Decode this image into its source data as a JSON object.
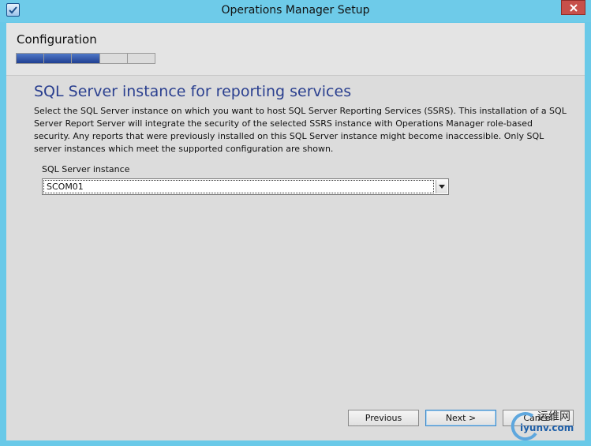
{
  "window": {
    "title": "Operations Manager Setup"
  },
  "header": {
    "step_title": "Configuration",
    "progress": {
      "total_segments": 5,
      "completed_segments": 3
    }
  },
  "main": {
    "heading": "SQL Server instance for reporting services",
    "description": "Select the SQL Server instance on which you want to host SQL Server Reporting Services (SSRS). This installation of a SQL Server Report Server will integrate the security of the selected SSRS instance with Operations Manager role-based security. Any reports that were previously installed on this SQL Server instance might become inaccessible.  Only SQL server instances which meet the supported configuration are shown.",
    "instance_label": "SQL Server instance",
    "instance_value": "SCOM01"
  },
  "footer": {
    "previous_label": "Previous",
    "next_label": "Next >",
    "cancel_label": "Cancel"
  },
  "watermark": {
    "brand": "iyunv.com",
    "chinese": "运维网"
  },
  "colors": {
    "title_bar": "#6ecbe9",
    "heading": "#2a3f8f",
    "progress_fill": "#203f92",
    "close_button": "#c7504a"
  }
}
